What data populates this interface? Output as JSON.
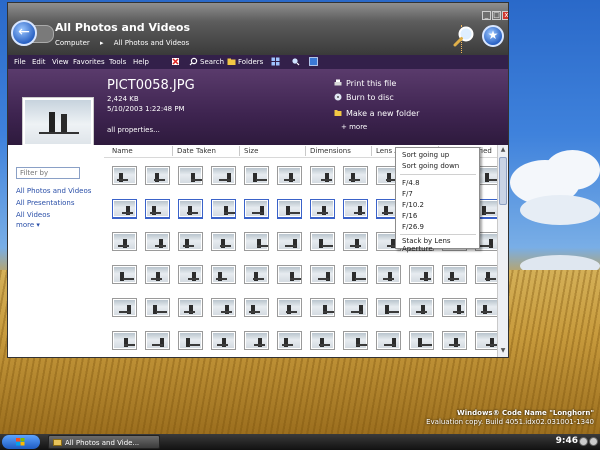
{
  "window": {
    "title": "All Photos and Videos",
    "breadcrumb": [
      "Computer",
      "All Photos and Videos"
    ],
    "controls": {
      "minimize": "_",
      "maximize": "□",
      "close": "x"
    }
  },
  "menubar": {
    "items": [
      "File",
      "Edit",
      "View",
      "Favorites",
      "Tools",
      "Help"
    ],
    "search_label": "Search",
    "folders_label": "Folders"
  },
  "details": {
    "file_name": "PICT0058.JPG",
    "file_size": "2,424 KB",
    "file_date": "5/10/2003 1:22:48 PM",
    "all_properties": "all properties...",
    "tasks": [
      "Print this file",
      "Burn to disc",
      "Make a new folder"
    ],
    "more": "+ more"
  },
  "leftnav": {
    "filter_placeholder": "Filter by",
    "links": [
      "All Photos and Videos",
      "All Presentations",
      "All Videos"
    ],
    "more": "more ▾"
  },
  "columns": [
    "Name",
    "Date Taken",
    "Size",
    "Dimensions",
    "Lens Aperture",
    "Date Modified"
  ],
  "context_menu": {
    "items": [
      "Sort going up",
      "Sort going down",
      "F/4.8",
      "F/7",
      "F/10.2",
      "F/16",
      "F/26.9",
      "Stack by Lens Aperture"
    ]
  },
  "taskbar": {
    "task_label": "All Photos and Vide...",
    "time": "9:46"
  },
  "watermark": {
    "line1": "Windows® Code Name \"Longhorn\"",
    "line2": "Evaluation copy. Build 4051.idx02.031001-1340"
  },
  "colors": {
    "detail_pane": "#3e2450",
    "menubar": "#33204a",
    "link": "#2a4fa8",
    "close": "#d0372e"
  },
  "icons": [
    "back-arrow-icon",
    "search-icon",
    "star-icon",
    "folder-icon",
    "printer-icon",
    "disc-icon",
    "new-folder-icon",
    "windows-flag-icon"
  ]
}
